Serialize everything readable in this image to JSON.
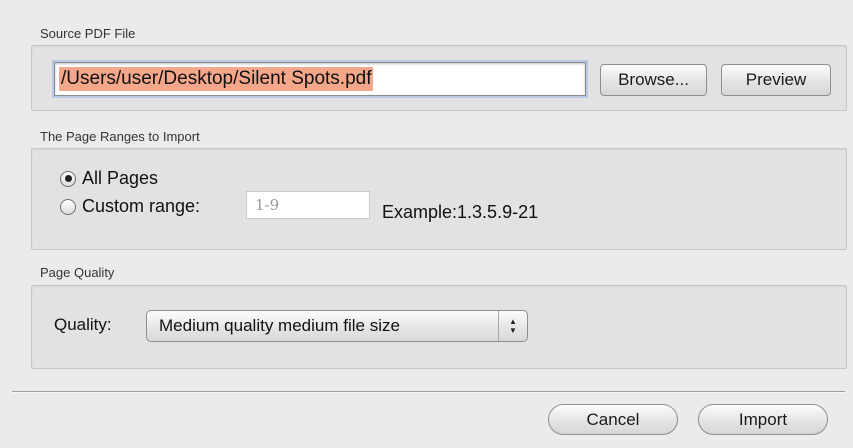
{
  "source": {
    "section_label": "Source PDF File",
    "path_value": "/Users/user/Desktop/Silent Spots.pdf",
    "browse_label": "Browse...",
    "preview_label": "Preview"
  },
  "ranges": {
    "section_label": "The Page Ranges to Import",
    "all_pages_label": "All Pages",
    "all_pages_selected": true,
    "custom_range_label": "Custom range:",
    "custom_range_placeholder": "1-9",
    "example_text": "Example:1.3.5.9-21"
  },
  "quality": {
    "section_label": "Page Quality",
    "field_label": "Quality:",
    "selected_option": "Medium quality medium file size",
    "arrow_icons": "up-down-arrows-icon"
  },
  "actions": {
    "cancel_label": "Cancel",
    "import_label": "Import"
  },
  "colors": {
    "selection_highlight": "#f4a78a",
    "focus_ring": "#b7c9e6",
    "panel_background": "#e2e2e2"
  }
}
